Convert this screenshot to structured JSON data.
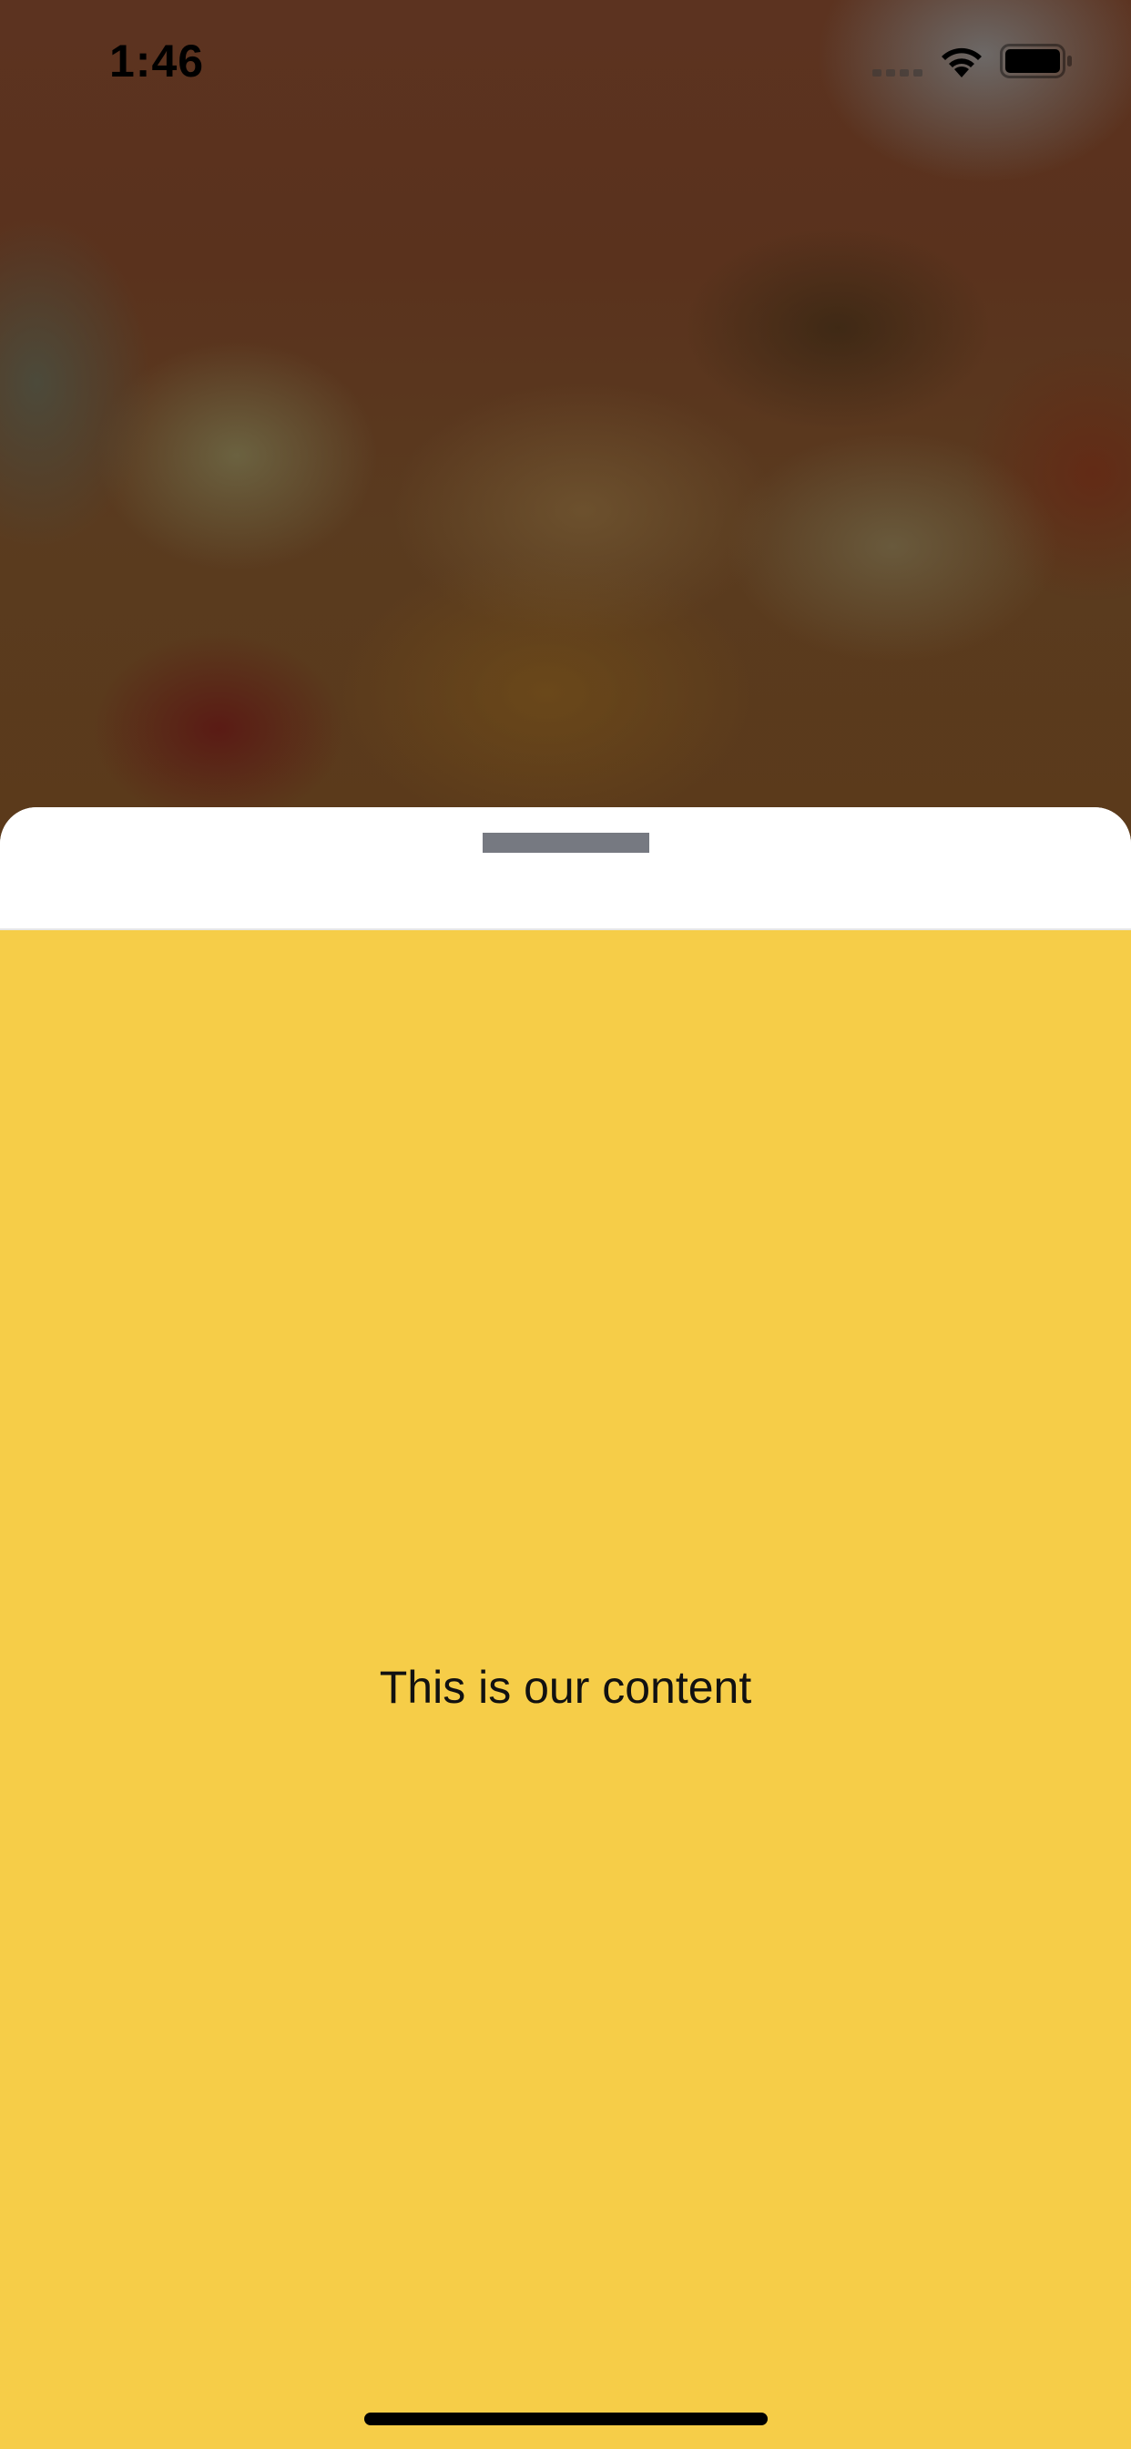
{
  "status_bar": {
    "time": "1:46",
    "icons": [
      "cellular-signal-icon",
      "wifi-icon",
      "battery-icon"
    ]
  },
  "sheet": {
    "content_text": "This is our content",
    "colors": {
      "header_background": "#ffffff",
      "content_background": "#f6cd48",
      "drag_handle": "#767981"
    }
  }
}
